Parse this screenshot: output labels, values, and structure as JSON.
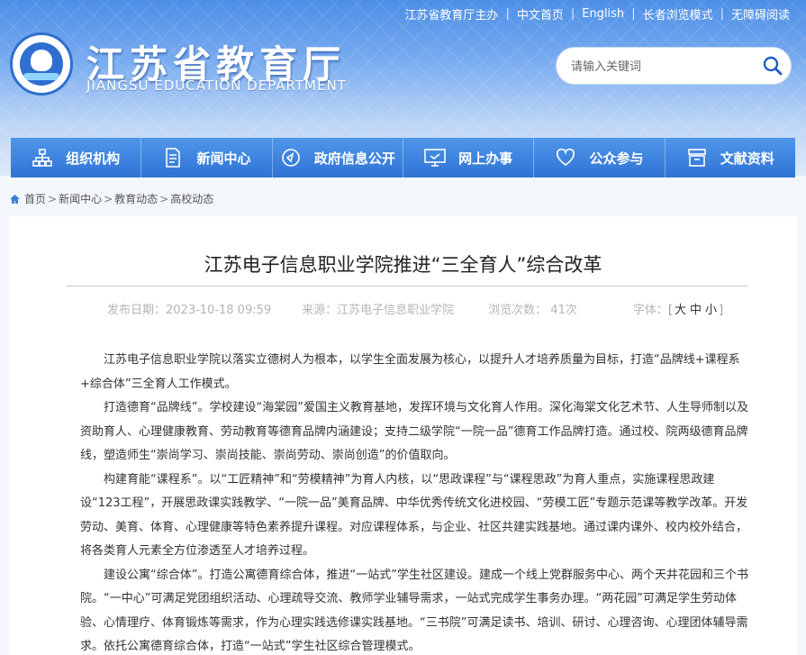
{
  "topbar": {
    "host": "江苏省教育厅主办",
    "cn_home": "中文首页",
    "english": "English",
    "elderly_mode": "长者浏览模式",
    "accessibility": "无障碍阅读"
  },
  "site": {
    "title": "江苏省教育厅",
    "subtitle": "JIANGSU EDUCATION DEPARTMENT"
  },
  "search": {
    "placeholder": "请输入关键词"
  },
  "nav": {
    "items": [
      {
        "label": "组织机构",
        "icon": "org-chart-icon"
      },
      {
        "label": "新闻中心",
        "icon": "document-icon"
      },
      {
        "label": "政府信息公开",
        "icon": "compass-icon"
      },
      {
        "label": "网上办事",
        "icon": "monitor-icon"
      },
      {
        "label": "公众参与",
        "icon": "heart-icon"
      },
      {
        "label": "文献资料",
        "icon": "archive-icon"
      }
    ]
  },
  "breadcrumb": [
    "首页",
    "新闻中心",
    "教育动态",
    "高校动态"
  ],
  "article": {
    "title": "江苏电子信息职业学院推进“三全育人”综合改革",
    "meta": {
      "date": "发布日期：2023-10-18 09:59",
      "source": "来源：江苏电子信息职业学院",
      "views": "浏览次数：  41次",
      "font_label": "字体：",
      "font_large": "大",
      "font_medium": "中",
      "font_small": "小"
    },
    "paragraphs": [
      "　　江苏电子信息职业学院以落实立德树人为根本，以学生全面发展为核心，以提升人才培养质量为目标，打造“品牌线+课程系+综合体”三全育人工作模式。",
      "　　打造德育“品牌线”。学校建设“海棠园”爱国主义教育基地，发挥环境与文化育人作用。深化海棠文化艺术节、人生导师制以及资助育人、心理健康教育、劳动教育等德育品牌内涵建设；支持二级学院“一院一品”德育工作品牌打造。通过校、院两级德育品牌线，塑造师生“崇尚学习、崇尚技能、崇尚劳动、崇尚创造”的价值取向。",
      "　　构建育能“课程系”。以“工匠精神”和“劳模精神”为育人内核，以“思政课程”与“课程思政”为育人重点，实施课程思政建设“123工程”，开展思政课实践教学、“一院一品”美育品牌、中华优秀传统文化进校园、“劳模工匠”专题示范课等教学改革。开发劳动、美育、体育、心理健康等特色素养提升课程。对应课程体系，与企业、社区共建实践基地。通过课内课外、校内校外结合，将各类育人元素全方位渗透至人才培养过程。",
      "　　建设公寓“综合体”。打造公寓德育综合体，推进“一站式”学生社区建设。建成一个线上党群服务中心、两个天井花园和三个书院。“一中心”可满足党团组织活动、心理疏导交流、教师学业辅导需求，一站式完成学生事务办理。“两花园”可满足学生劳动体验、心情理疗、体育锻炼等需求，作为心理实践选修课实践基地。“三书院”可满足读书、培训、研讨、心理咨询、心理团体辅导需求。依托公寓德育综合体，打造“一站式”学生社区综合管理模式。"
    ]
  },
  "colors": {
    "nav_blue": "#2f73d4",
    "header_blue": "#4c8ee6"
  }
}
